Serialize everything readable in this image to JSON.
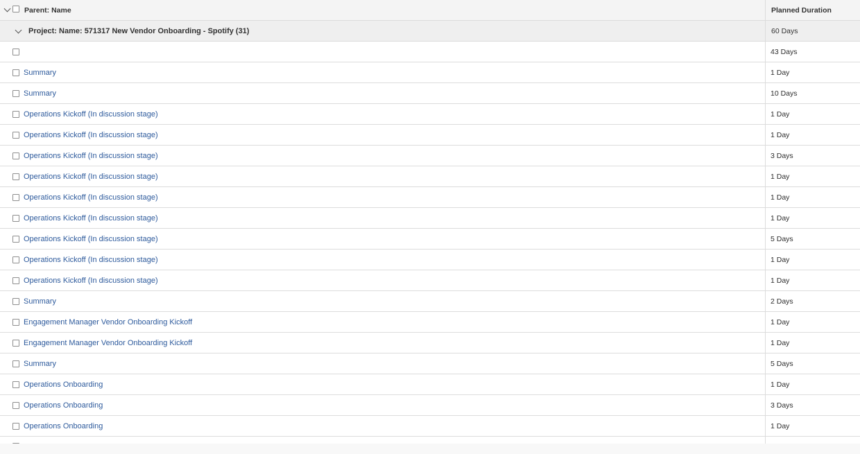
{
  "header": {
    "name_label": "Parent: Name",
    "duration_label": "Planned Duration"
  },
  "group": {
    "label": "Project: Name: 571317 New Vendor Onboarding - Spotify (31)",
    "duration": "60 Days"
  },
  "rows": [
    {
      "name": "",
      "duration": "43 Days"
    },
    {
      "name": "Summary",
      "duration": "1 Day"
    },
    {
      "name": "Summary",
      "duration": "10 Days"
    },
    {
      "name": "Operations Kickoff (In discussion stage)",
      "duration": "1 Day"
    },
    {
      "name": "Operations Kickoff (In discussion stage)",
      "duration": "1 Day"
    },
    {
      "name": "Operations Kickoff (In discussion stage)",
      "duration": "3 Days"
    },
    {
      "name": "Operations Kickoff (In discussion stage)",
      "duration": "1 Day"
    },
    {
      "name": "Operations Kickoff (In discussion stage)",
      "duration": "1 Day"
    },
    {
      "name": "Operations Kickoff (In discussion stage)",
      "duration": "1 Day"
    },
    {
      "name": "Operations Kickoff (In discussion stage)",
      "duration": "5 Days"
    },
    {
      "name": "Operations Kickoff (In discussion stage)",
      "duration": "1 Day"
    },
    {
      "name": "Operations Kickoff (In discussion stage)",
      "duration": "1 Day"
    },
    {
      "name": "Summary",
      "duration": "2 Days"
    },
    {
      "name": "Engagement Manager Vendor Onboarding Kickoff",
      "duration": "1 Day"
    },
    {
      "name": "Engagement Manager Vendor Onboarding Kickoff",
      "duration": "1 Day"
    },
    {
      "name": "Summary",
      "duration": "5 Days"
    },
    {
      "name": "Operations Onboarding",
      "duration": "1 Day"
    },
    {
      "name": "Operations Onboarding",
      "duration": "3 Days"
    },
    {
      "name": "Operations Onboarding",
      "duration": "1 Day"
    }
  ],
  "colors": {
    "link": "#2d5a9c",
    "header_bg": "#f4f4f4",
    "group_bg": "#efefef",
    "border": "#dcdcdc"
  }
}
